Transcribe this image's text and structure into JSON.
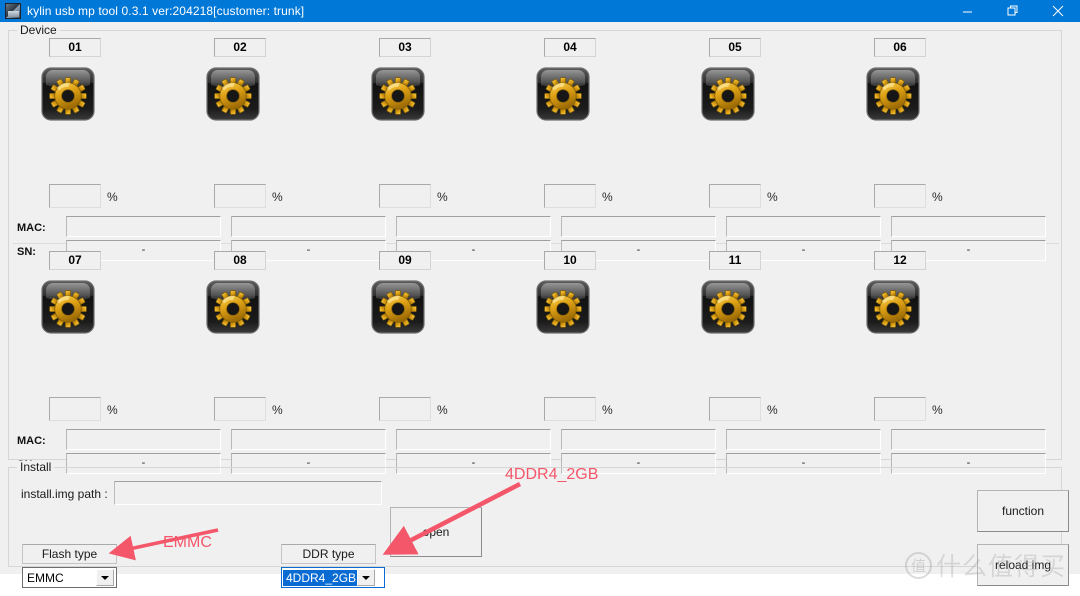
{
  "window": {
    "title": "kylin usb mp tool 0.3.1 ver:204218[customer: trunk]",
    "icon": "app-icon",
    "minimize_label": "minimize-icon",
    "maximize_label": "restore-icon",
    "close_label": "close-icon"
  },
  "device_group": {
    "title": "Device",
    "mac_label": "MAC:",
    "sn_label": "SN:",
    "percent_label": "%",
    "cells": [
      {
        "number": "01",
        "percent": "",
        "mac": "",
        "sn": "-"
      },
      {
        "number": "02",
        "percent": "",
        "mac": "",
        "sn": "-"
      },
      {
        "number": "03",
        "percent": "",
        "mac": "",
        "sn": "-"
      },
      {
        "number": "04",
        "percent": "",
        "mac": "",
        "sn": "-"
      },
      {
        "number": "05",
        "percent": "",
        "mac": "",
        "sn": "-"
      },
      {
        "number": "06",
        "percent": "",
        "mac": "",
        "sn": "-"
      },
      {
        "number": "07",
        "percent": "",
        "mac": "",
        "sn": "-"
      },
      {
        "number": "08",
        "percent": "",
        "mac": "",
        "sn": "-"
      },
      {
        "number": "09",
        "percent": "",
        "mac": "",
        "sn": "-"
      },
      {
        "number": "10",
        "percent": "",
        "mac": "",
        "sn": "-"
      },
      {
        "number": "11",
        "percent": "",
        "mac": "",
        "sn": "-"
      },
      {
        "number": "12",
        "percent": "",
        "mac": "",
        "sn": "-"
      }
    ]
  },
  "install_group": {
    "title": "Install",
    "path_label": "install.img path :",
    "path_value": "",
    "path_placeholder": "",
    "open_button": "open",
    "flash_type_caption": "Flash type",
    "flash_type_value": "EMMC",
    "ddr_type_caption": "DDR type",
    "ddr_type_value": "4DDR4_2GB",
    "function_button": "function",
    "reload_button": "reload img"
  },
  "annotations": [
    {
      "text": "EMMC",
      "color": "#f4566a"
    },
    {
      "text": "4DDR4_2GB",
      "color": "#f4566a"
    }
  ],
  "watermark": {
    "mark": "值",
    "text": "什么值得买"
  },
  "colors": {
    "titlebar": "#0078d7",
    "client": "#f0f0f0",
    "annotation": "#f4566a",
    "selection": "#0a6cd2"
  }
}
